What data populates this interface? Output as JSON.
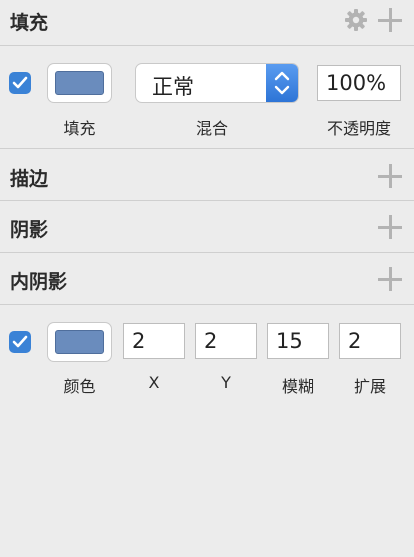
{
  "fill": {
    "title": "填充",
    "enabled": true,
    "color": "#6a8cbd",
    "blend_mode": "正常",
    "opacity": "100%",
    "labels": {
      "fill": "填充",
      "blend": "混合",
      "opacity": "不透明度"
    }
  },
  "border": {
    "title": "描边"
  },
  "shadow": {
    "title": "阴影"
  },
  "inner_shadow": {
    "title": "内阴影",
    "enabled": true,
    "color": "#6a8cbd",
    "x": "2",
    "y": "2",
    "blur": "15",
    "spread": "2",
    "labels": {
      "color": "颜色",
      "x": "X",
      "y": "Y",
      "blur": "模糊",
      "spread": "扩展"
    }
  },
  "accent_color": "#3a82d6"
}
